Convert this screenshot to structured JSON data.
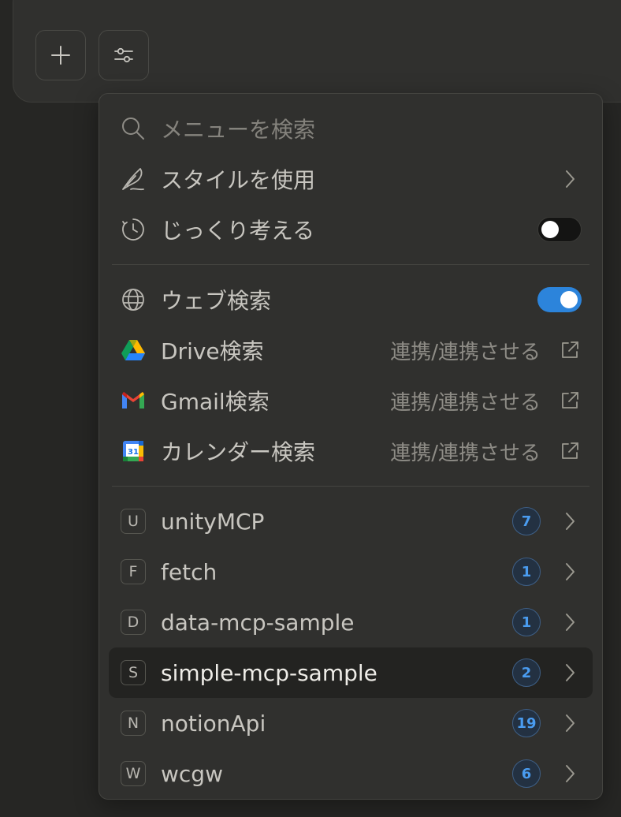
{
  "menu": {
    "search": {
      "placeholder": "メニューを検索"
    },
    "style": {
      "label": "スタイルを使用"
    },
    "think": {
      "label": "じっくり考える",
      "enabled": false
    },
    "web": {
      "label": "ウェブ検索",
      "enabled": true
    },
    "integrations": [
      {
        "label": "Drive検索",
        "action": "連携/連携させる",
        "icon": "google-drive-icon"
      },
      {
        "label": "Gmail検索",
        "action": "連携/連携させる",
        "icon": "gmail-icon"
      },
      {
        "label": "カレンダー検索",
        "action": "連携/連携させる",
        "icon": "google-calendar-icon",
        "icon_text": "31"
      }
    ],
    "servers": [
      {
        "letter": "U",
        "name": "unityMCP",
        "count": "7"
      },
      {
        "letter": "F",
        "name": "fetch",
        "count": "1"
      },
      {
        "letter": "D",
        "name": "data-mcp-sample",
        "count": "1"
      },
      {
        "letter": "S",
        "name": "simple-mcp-sample",
        "count": "2",
        "highlighted": true
      },
      {
        "letter": "N",
        "name": "notionApi",
        "count": "19"
      },
      {
        "letter": "W",
        "name": "wcgw",
        "count": "6"
      }
    ]
  },
  "colors": {
    "accent": "#2c84db",
    "badge_text": "#4a9cf0"
  }
}
